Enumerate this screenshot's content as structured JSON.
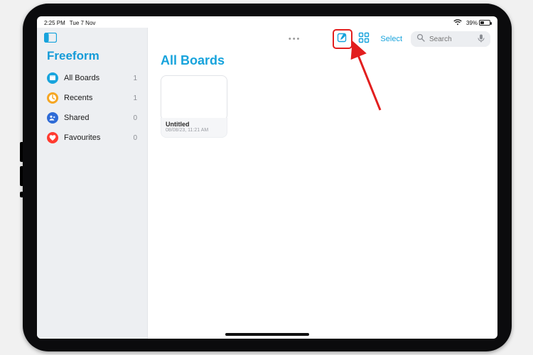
{
  "status": {
    "time": "2:25 PM",
    "date": "Tue 7 Nov",
    "battery_pct": "39%"
  },
  "app": {
    "title": "Freeform"
  },
  "sidebar": {
    "items": [
      {
        "label": "All Boards",
        "count": "1"
      },
      {
        "label": "Recents",
        "count": "1"
      },
      {
        "label": "Shared",
        "count": "0"
      },
      {
        "label": "Favourites",
        "count": "0"
      }
    ]
  },
  "toolbar": {
    "select_label": "Select"
  },
  "search": {
    "placeholder": "Search"
  },
  "section": {
    "title": "All Boards"
  },
  "boards": [
    {
      "title": "Untitled",
      "subtitle": "08/08/23, 11:21 AM"
    }
  ],
  "colors": {
    "accent": "#17a3dc",
    "highlight": "#e21e1e"
  }
}
